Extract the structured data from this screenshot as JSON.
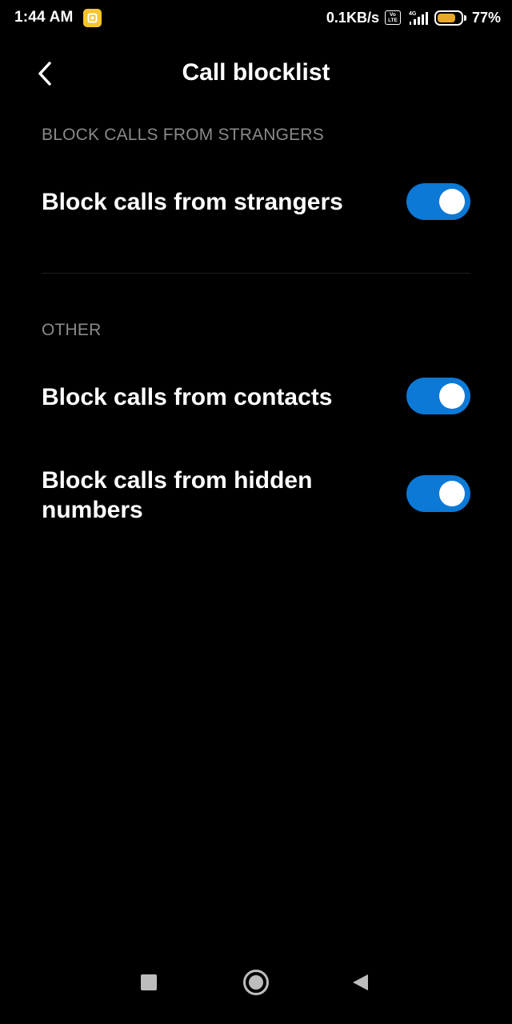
{
  "status_bar": {
    "time": "1:44 AM",
    "network_speed": "0.1KB/s",
    "volte_top": "Vo",
    "volte_bottom": "LTE",
    "network_type": "4G",
    "battery_percent": "77%",
    "battery_level": 0.77,
    "notification_icon": "gallery-icon",
    "battery_color": "#e9a827"
  },
  "header": {
    "title": "Call blocklist",
    "back_icon": "chevron-left-icon"
  },
  "sections": [
    {
      "header": "BLOCK CALLS FROM STRANGERS",
      "items": [
        {
          "label": "Block calls from strangers",
          "enabled": true
        }
      ]
    },
    {
      "header": "OTHER",
      "items": [
        {
          "label": "Block calls from contacts",
          "enabled": true
        },
        {
          "label": "Block calls from hidden numbers",
          "enabled": true
        }
      ]
    }
  ],
  "colors": {
    "background": "#000000",
    "toggle_on": "#0c79d6",
    "section_header": "#8a8a8a"
  },
  "nav_bar": {
    "recents_icon": "square-icon",
    "home_icon": "circle-icon",
    "back_icon": "triangle-back-icon"
  }
}
